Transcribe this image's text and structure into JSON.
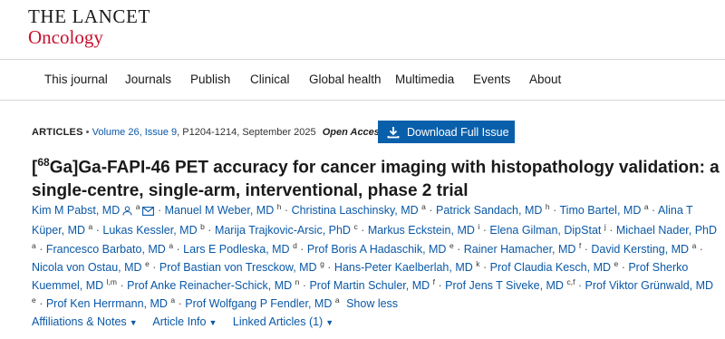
{
  "logo": {
    "line1": "THE LANCET",
    "line2": "Oncology"
  },
  "nav": [
    "This journal",
    "Journals",
    "Publish",
    "Clinical",
    "Global health",
    "Multimedia",
    "Events",
    "About"
  ],
  "meta": {
    "type": "ARTICLES",
    "volume": "Volume 26, Issue 9",
    "pages": ", P1204-1214, September 2025",
    "open_access": "Open Access",
    "download": "Download Full Issue"
  },
  "title": {
    "pre": "[",
    "isotope": "68",
    "post": "Ga]Ga-FAPI-46 PET accuracy for cancer imaging with histopathology validation: a single-centre, single-arm, interventional, phase 2 trial"
  },
  "authors": [
    {
      "name": "Kim M Pabst, MD",
      "aff": "a",
      "icons": true
    },
    {
      "name": "Manuel M Weber, MD",
      "aff": "h"
    },
    {
      "name": "Christina Laschinsky, MD",
      "aff": "a"
    },
    {
      "name": "Patrick Sandach, MD",
      "aff": "h"
    },
    {
      "name": "Timo Bartel, MD",
      "aff": "a"
    },
    {
      "name": "Alina T Küper, MD",
      "aff": "a"
    },
    {
      "name": "Lukas Kessler, MD",
      "aff": "b"
    },
    {
      "name": "Marija Trajkovic-Arsic, PhD",
      "aff": "c"
    },
    {
      "name": "Markus Eckstein, MD",
      "aff": "i"
    },
    {
      "name": "Elena Gilman, DipStat",
      "aff": "j"
    },
    {
      "name": "Michael Nader, PhD",
      "aff": "a"
    },
    {
      "name": "Francesco Barbato, MD",
      "aff": "a"
    },
    {
      "name": "Lars E Podleska, MD",
      "aff": "d"
    },
    {
      "name": "Prof Boris A Hadaschik, MD",
      "aff": "e"
    },
    {
      "name": "Rainer Hamacher, MD",
      "aff": "f"
    },
    {
      "name": "David Kersting, MD",
      "aff": "a"
    },
    {
      "name": "Nicola von Ostau, MD",
      "aff": "e"
    },
    {
      "name": "Prof Bastian von Tresckow, MD",
      "aff": "g"
    },
    {
      "name": "Hans-Peter Kaelberlah, MD",
      "aff": "k"
    },
    {
      "name": "Prof Claudia Kesch, MD",
      "aff": "e"
    },
    {
      "name": "Prof Sherko Kuemmel, MD",
      "aff": "l,m"
    },
    {
      "name": "Prof Anke Reinacher-Schick, MD",
      "aff": "n"
    },
    {
      "name": "Prof Martin Schuler, MD",
      "aff": "f"
    },
    {
      "name": "Prof Jens T Siveke, MD",
      "aff": "c,f"
    },
    {
      "name": "Prof Viktor Grünwald, MD",
      "aff": "e"
    },
    {
      "name": "Prof Ken Herrmann, MD",
      "aff": "a"
    },
    {
      "name": "Prof Wolfgang P Fendler, MD",
      "aff": "a"
    }
  ],
  "show_less": "Show less",
  "bottom_links": [
    "Affiliations & Notes",
    "Article Info",
    "Linked Articles (1)"
  ]
}
